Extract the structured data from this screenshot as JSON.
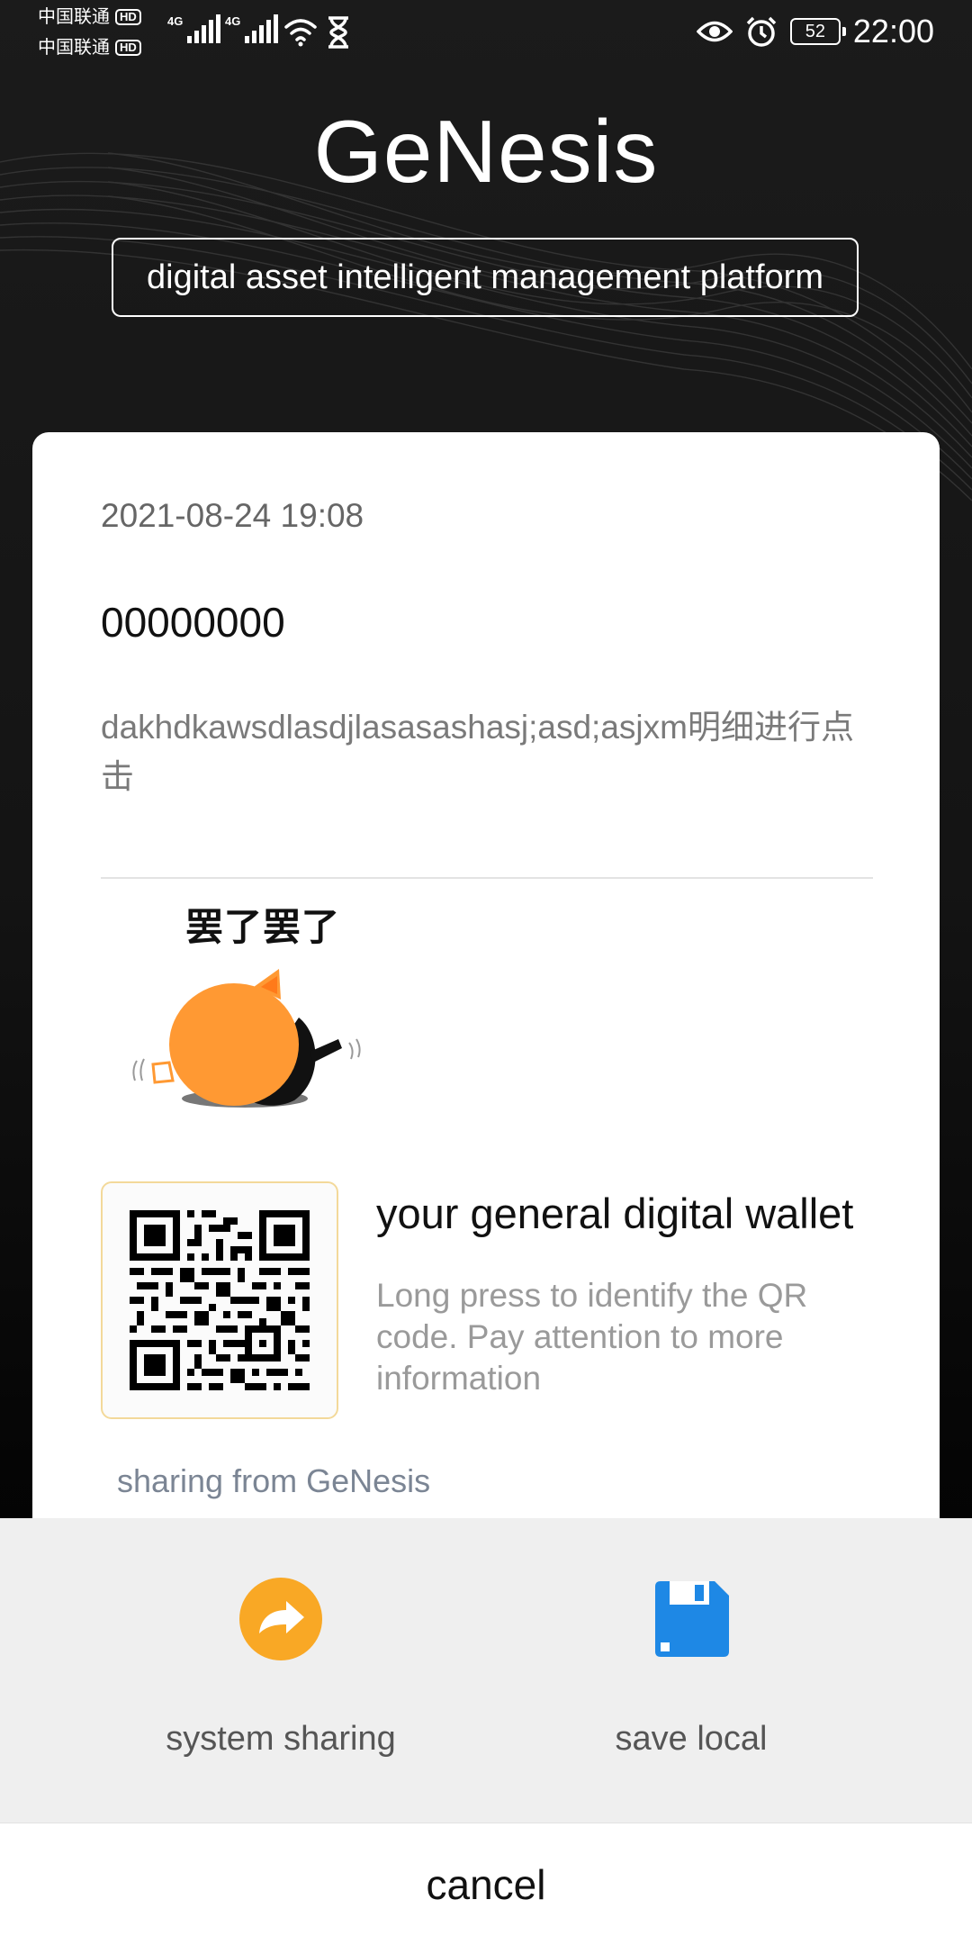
{
  "status_bar": {
    "carrier1": "中国联通",
    "carrier2": "中国联通",
    "hd_badge": "HD",
    "network_type": "4G",
    "battery_level": "52",
    "time": "22:00",
    "icons": [
      "eye-icon",
      "alarm-icon",
      "wifi-icon",
      "hourglass-icon",
      "signal-icon"
    ]
  },
  "header": {
    "title": "GeNesis",
    "subtitle": "digital asset intelligent management platform"
  },
  "card": {
    "date": "2021-08-24 19:08",
    "code": "00000000",
    "description": "dakhdkawsdlasdjlasasashasj;asd;asjxm明细进行点击",
    "sticker_text": "罢了罢了",
    "qr": {
      "title": "your general digital wallet",
      "description": "Long press to identify the QR code. Pay attention to more information"
    },
    "footer": "sharing from GeNesis"
  },
  "sheet": {
    "actions": [
      {
        "label": "system sharing",
        "icon": "share-arrow-icon",
        "color": "#f9a825"
      },
      {
        "label": "save local",
        "icon": "floppy-disk-icon",
        "color": "#1e88e5"
      }
    ],
    "cancel": "cancel"
  },
  "colors": {
    "background_dark": "#141414",
    "card": "#ffffff",
    "sheet": "#efefef",
    "qr_border": "#f3d99a",
    "share_orange": "#f9a825",
    "save_blue": "#1e88e5"
  }
}
